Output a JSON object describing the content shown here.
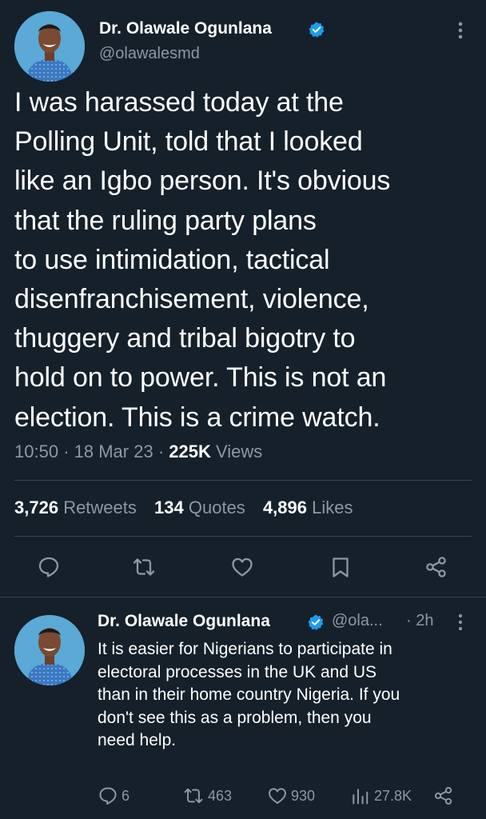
{
  "main_tweet": {
    "author_name": "Dr. Olawale Ogunlana",
    "handle": "@olawalesmd",
    "text_lines": [
      "I was harassed today at the",
      "Polling Unit, told that I looked",
      "like an Igbo person. It's obvious",
      "that the ruling party plans",
      "to use intimidation, tactical",
      "disenfranchisement, violence,",
      "thuggery and tribal bigotry to",
      "hold on to power. This is not an",
      "election. This is a crime watch."
    ],
    "time": "10:50",
    "date": "18 Mar 23",
    "separator": "·",
    "views_count": "225K",
    "views_label": "Views",
    "retweets_count": "3,726",
    "retweets_label": "Retweets",
    "quotes_count": "134",
    "quotes_label": "Quotes",
    "likes_count": "4,896",
    "likes_label": "Likes",
    "actions": [
      "reply-icon",
      "retweet-icon",
      "like-icon",
      "bookmark-icon",
      "share-icon"
    ]
  },
  "reply_tweet": {
    "author_name": "Dr. Olawale Ogunlana",
    "handle": "@ola...",
    "time": "· 2h",
    "text_lines": [
      "It is easier for Nigerians to participate in",
      "electoral processes in the UK and US",
      "than in their home country Nigeria. If you",
      "don't see this as a problem, then  you",
      "need help."
    ],
    "reply_count": "6",
    "retweet_count": "463",
    "like_count": "930",
    "views_count": "27.8K"
  },
  "colors": {
    "background": "#15202b",
    "text": "#ffffff",
    "muted": "#8b98a5",
    "verified": "#1d9bf0",
    "divider": "#38444d"
  }
}
